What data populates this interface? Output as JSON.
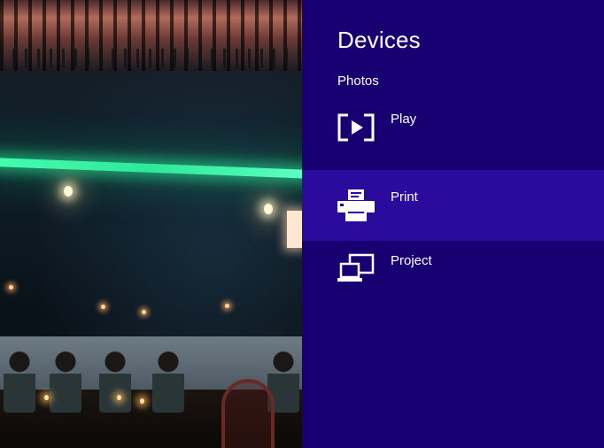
{
  "panel": {
    "title": "Devices",
    "subtitle": "Photos",
    "items": [
      {
        "label": "Play",
        "icon": "play-icon",
        "selected": false
      },
      {
        "label": "Print",
        "icon": "printer-icon",
        "selected": true
      },
      {
        "label": "Project",
        "icon": "project-icon",
        "selected": false
      }
    ]
  },
  "colors": {
    "panel_background": "#180073",
    "selected_background": "#2b0a9e",
    "text": "#ffffff"
  }
}
